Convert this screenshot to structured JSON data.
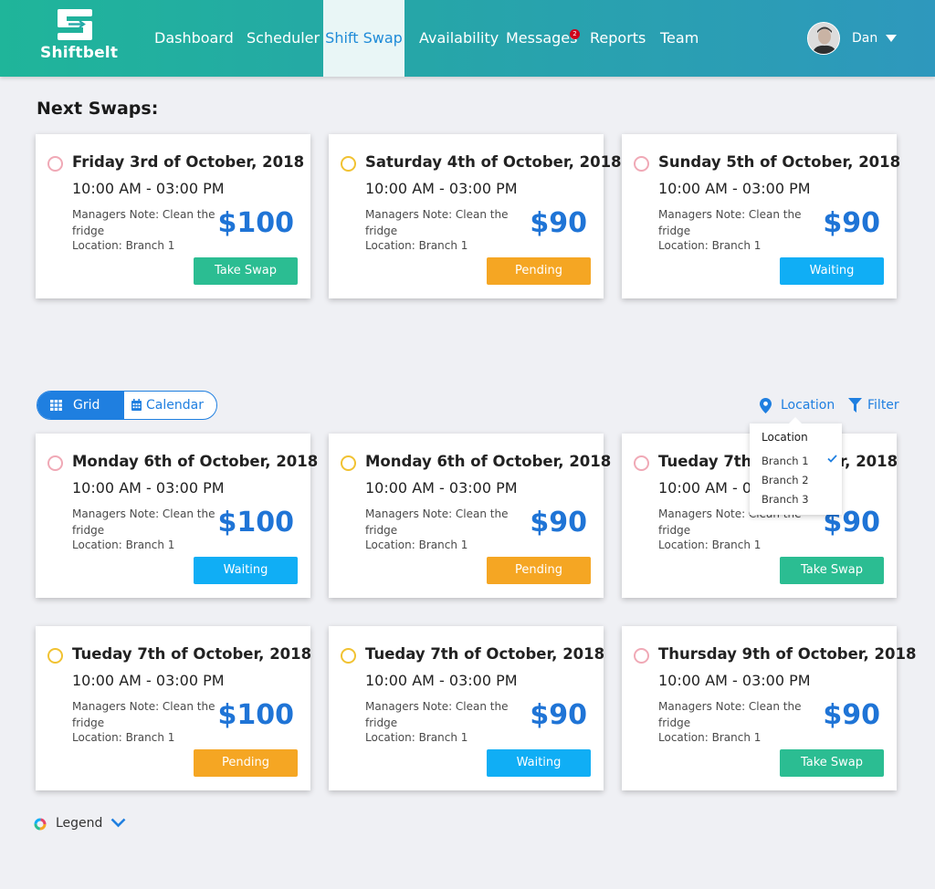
{
  "app": {
    "name": "Shiftbelt",
    "nav": [
      {
        "label": "Dashboard"
      },
      {
        "label": "Scheduler"
      },
      {
        "label": "Shift Swap",
        "active": true
      },
      {
        "label": "Availability"
      },
      {
        "label": "Messages",
        "badge": "2"
      },
      {
        "label": "Reports"
      },
      {
        "label": "Team"
      }
    ],
    "user": {
      "name": "Dan"
    }
  },
  "next_swaps": {
    "title": "Next Swaps:",
    "cards": [
      {
        "date": "Friday 3rd of October, 2018",
        "time": "10:00 AM - 03:00 PM",
        "note": "Managers Note: Clean the fridge",
        "location": "Location: Branch 1",
        "price": "$100",
        "button": "Take Swap",
        "status": "take",
        "ring": "pink"
      },
      {
        "date": "Saturday 4th of October, 2018",
        "time": "10:00 AM - 03:00 PM",
        "note": "Managers Note: Clean the fridge",
        "location": "Location: Branch 1",
        "price": "$90",
        "button": "Pending",
        "status": "pending",
        "ring": "yellow"
      },
      {
        "date": "Sunday 5th of October, 2018",
        "time": "10:00 AM - 03:00 PM",
        "note": "Managers Note: Clean the fridge",
        "location": "Location: Branch 1",
        "price": "$90",
        "button": "Waiting",
        "status": "waiting",
        "ring": "pink"
      }
    ]
  },
  "view_toggle": {
    "grid": "Grid",
    "calendar": "Calendar",
    "selected": "Grid"
  },
  "location_filter": {
    "label": "Location",
    "dropdown_title": "Location",
    "options": [
      {
        "label": "Branch 1",
        "checked": true
      },
      {
        "label": "Branch 2",
        "checked": false
      },
      {
        "label": "Branch 3",
        "checked": false
      }
    ]
  },
  "filter": {
    "label": "Filter"
  },
  "grid": {
    "cards": [
      {
        "date": "Monday 6th of October, 2018",
        "time": "10:00 AM - 03:00 PM",
        "note": "Managers Note: Clean the fridge",
        "location": "Location: Branch 1",
        "price": "$100",
        "button": "Waiting",
        "status": "waiting",
        "ring": "pink"
      },
      {
        "date": "Monday 6th of October, 2018",
        "time": "10:00 AM - 03:00 PM",
        "note": "Managers Note: Clean the fridge",
        "location": "Location: Branch 1",
        "price": "$90",
        "button": "Pending",
        "status": "pending",
        "ring": "yellow"
      },
      {
        "date": "Tueday 7th of October, 2018",
        "time": "10:00 AM - 03:00 PM",
        "note": "Managers Note: Clean the fridge",
        "location": "Location: Branch 1",
        "price": "$90",
        "button": "Take Swap",
        "status": "take",
        "ring": "pink"
      },
      {
        "date": "Tueday 7th of October, 2018",
        "time": "10:00 AM - 03:00 PM",
        "note": "Managers Note: Clean the fridge",
        "location": "Location: Branch 1",
        "price": "$100",
        "button": "Pending",
        "status": "pending",
        "ring": "yellow"
      },
      {
        "date": "Tueday 7th of October, 2018",
        "time": "10:00 AM - 03:00 PM",
        "note": "Managers Note: Clean the fridge",
        "location": "Location: Branch 1",
        "price": "$90",
        "button": "Waiting",
        "status": "waiting",
        "ring": "yellow"
      },
      {
        "date": "Thursday 9th of October, 2018",
        "time": "10:00 AM - 03:00 PM",
        "note": "Managers Note: Clean the fridge",
        "location": "Location: Branch 1",
        "price": "$90",
        "button": "Take Swap",
        "status": "take",
        "ring": "pink"
      }
    ]
  },
  "legend": {
    "label": "Legend"
  },
  "colors": {
    "take": "#2bbd92",
    "pending": "#f5a623",
    "waiting": "#10aef5",
    "ring_pink": "#f0a9b6",
    "ring_yellow": "#f1c232",
    "accent": "#1f7fe0"
  }
}
